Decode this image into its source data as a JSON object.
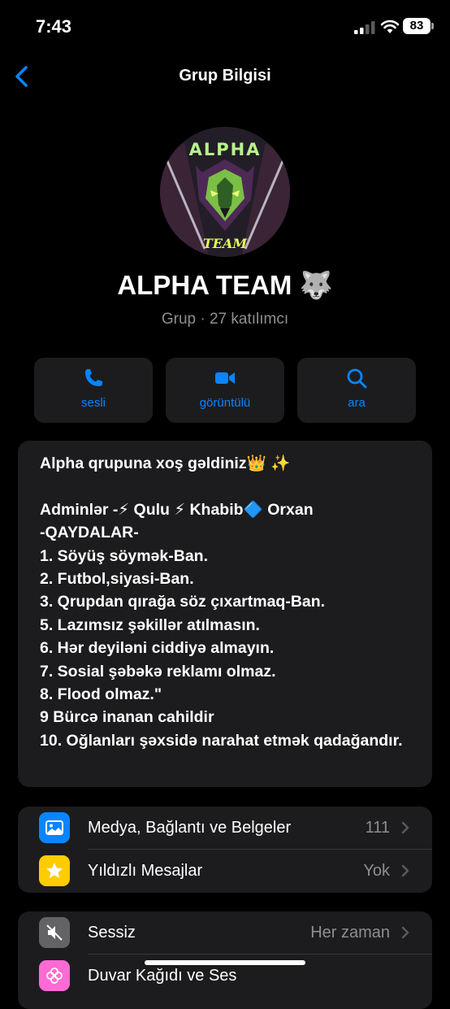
{
  "status_bar": {
    "time": "7:43",
    "battery": "83"
  },
  "nav": {
    "title": "Grup Bilgisi"
  },
  "group": {
    "name": "ALPHA TEAM 🐺",
    "subtitle": "Grup · 27 katılımcı",
    "avatar_text_top": "ALPHA",
    "avatar_text_bottom": "TEAM"
  },
  "actions": [
    {
      "label": "sesli",
      "icon": "phone-icon"
    },
    {
      "label": "görüntülü",
      "icon": "video-icon"
    },
    {
      "label": "ara",
      "icon": "search-icon"
    }
  ],
  "description": "Alpha  qrupuna xoş gəldiniz👑 ✨\n\nAdminlər -⚡ Qulu ⚡ Khabib🔷 Orxan\n-QAYDALAR-\n1. Söyüş söymək-Ban.\n2. Futbol,siyasi-Ban.\n3. Qrupdan qırağa söz çıxartmaq-Ban.\n5. Lazımsız şəkillər atılmasın.\n6. Hər deyiləni ciddiyə almayın.\n7. Sosial şəbəkə reklamı olmaz.\n8. Flood olmaz.\"\n9 Bürcə inanan cahildir\n10. Oğlanları şəxsidə narahat etmək qadağandır.",
  "media_section": [
    {
      "label": "Medya, Bağlantı ve Belgeler",
      "value": "111",
      "icon": "photo-icon",
      "color": "#0a84ff"
    },
    {
      "label": "Yıldızlı Mesajlar",
      "value": "Yok",
      "icon": "star-icon",
      "color": "#ffcc00"
    }
  ],
  "settings_section": [
    {
      "label": "Sessiz",
      "value": "Her zaman",
      "icon": "mute-icon",
      "color": "#636366"
    },
    {
      "label": "Duvar Kağıdı ve Ses",
      "value": "",
      "icon": "flower-icon",
      "color": "#ff6ad5"
    }
  ]
}
